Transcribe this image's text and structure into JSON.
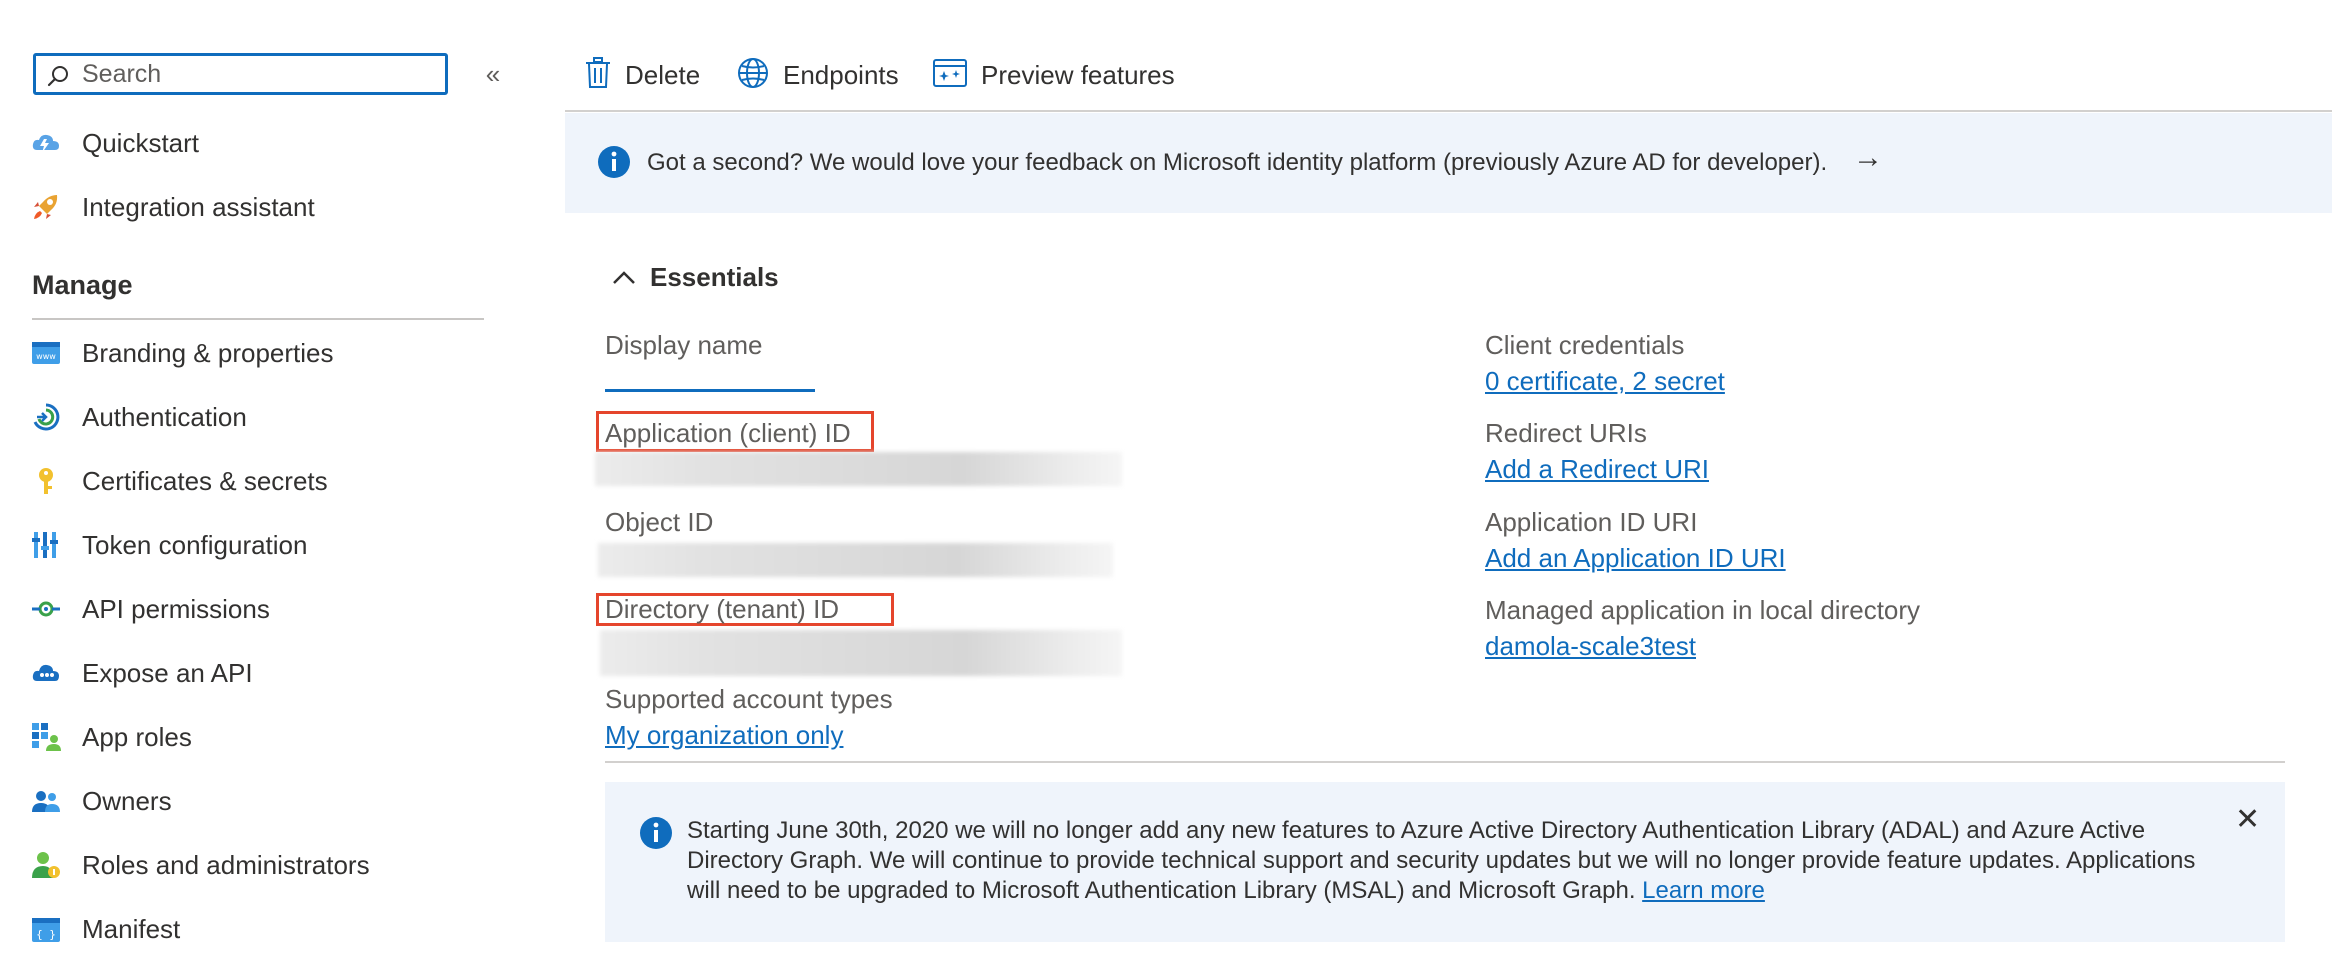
{
  "sidebar": {
    "search_placeholder": "Search",
    "collapse_glyph": "«",
    "items_top": [
      {
        "label": "Quickstart",
        "icon": "cloud-lightning-icon"
      },
      {
        "label": "Integration assistant",
        "icon": "rocket-icon"
      }
    ],
    "manage_header": "Manage",
    "items_manage": [
      {
        "label": "Branding & properties",
        "icon": "www-icon"
      },
      {
        "label": "Authentication",
        "icon": "authentication-icon"
      },
      {
        "label": "Certificates & secrets",
        "icon": "key-icon"
      },
      {
        "label": "Token configuration",
        "icon": "token-bars-icon"
      },
      {
        "label": "API permissions",
        "icon": "api-permissions-icon"
      },
      {
        "label": "Expose an API",
        "icon": "cloud-api-icon"
      },
      {
        "label": "App roles",
        "icon": "app-roles-grid-icon"
      },
      {
        "label": "Owners",
        "icon": "people-icon"
      },
      {
        "label": "Roles and administrators",
        "icon": "person-admin-icon"
      },
      {
        "label": "Manifest",
        "icon": "manifest-icon"
      }
    ]
  },
  "toolbar": {
    "delete_label": "Delete",
    "endpoints_label": "Endpoints",
    "preview_label": "Preview features"
  },
  "feedback": {
    "message": "Got a second? We would love your feedback on Microsoft identity platform (previously Azure AD for developer).",
    "arrow": "→"
  },
  "essentials": {
    "toggle_label": "Essentials",
    "left": {
      "display_name_label": "Display name",
      "app_client_id_label": "Application (client) ID",
      "object_id_label": "Object ID",
      "directory_tenant_id_label": "Directory (tenant) ID",
      "supported_account_types_label": "Supported account types",
      "supported_account_types_value": "My organization only"
    },
    "right": {
      "client_credentials_label": "Client credentials",
      "client_credentials_value": "0 certificate, 2 secret",
      "redirect_uris_label": "Redirect URIs",
      "redirect_uris_value": "Add a Redirect URI",
      "app_id_uri_label": "Application ID URI",
      "app_id_uri_value": "Add an Application ID URI",
      "managed_app_label": "Managed application in local directory",
      "managed_app_value": "damola-scale3test"
    }
  },
  "notice": {
    "text": "Starting June 30th, 2020 we will no longer add any new features to Azure Active Directory Authentication Library (ADAL) and Azure Active Directory Graph. We will continue to provide technical support and security updates but we will no longer provide feature updates. Applications will need to be upgraded to Microsoft Authentication Library (MSAL) and Microsoft Graph.",
    "link": "Learn more",
    "close_glyph": "✕"
  },
  "colors": {
    "accent": "#0f6cbd",
    "highlight_red": "#e5452c",
    "banner_bg": "#eff4fb"
  }
}
